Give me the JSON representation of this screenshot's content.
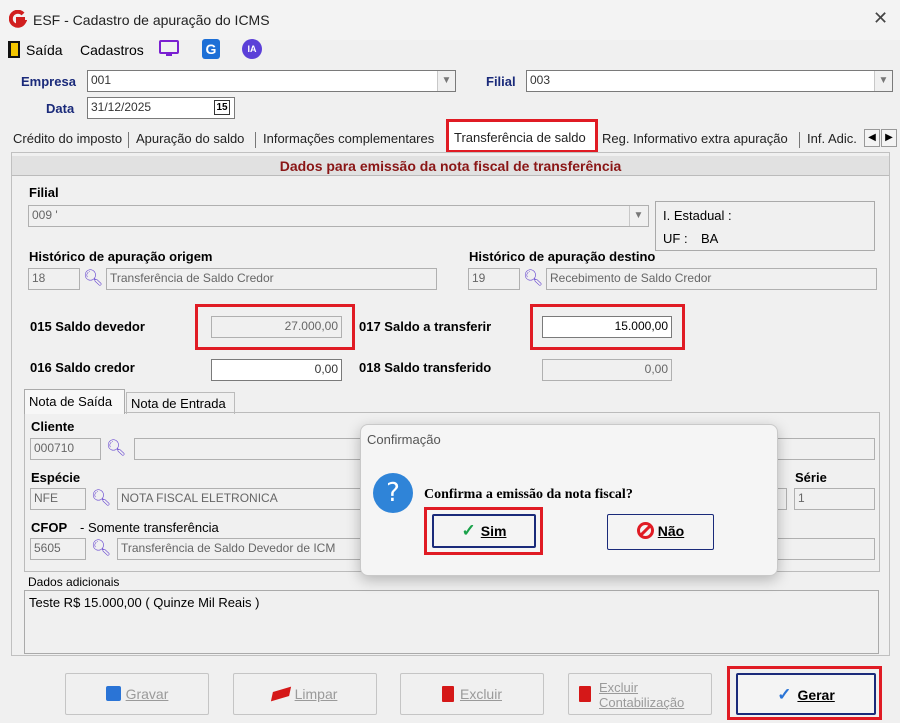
{
  "window": {
    "title": "ESF - Cadastro de apuração do ICMS"
  },
  "menu": {
    "exit": "Saída",
    "registrations": "Cadastros",
    "ai": "IA",
    "g": "G"
  },
  "header": {
    "company_label": "Empresa",
    "company_value": "001",
    "branch_label": "Filial",
    "branch_value": "003",
    "date_label": "Data",
    "date_value": "31/12/2025",
    "calendar": "15"
  },
  "tabs": [
    "Crédito do imposto",
    "Apuração do saldo",
    "Informações complementares",
    "Transferência de saldo",
    "Reg. Informativo extra apuração",
    "Inf. Adic."
  ],
  "panel": {
    "title": "Dados para emissão da nota fiscal de transferência",
    "branch_label": "Filial",
    "branch_value": "009 '",
    "state_reg_label": "I. Estadual :",
    "uf_label": "UF :",
    "uf_value": "BA",
    "hist_origin_label": "Histórico de apuração origem",
    "hist_origin_code": "18",
    "hist_origin_desc": "Transferência de Saldo Credor",
    "hist_dest_label": "Histórico de apuração destino",
    "hist_dest_code": "19",
    "hist_dest_desc": "Recebimento de Saldo Credor",
    "debit_label": "015  Saldo devedor",
    "debit_value": "27.000,00",
    "transfer_label": "017  Saldo a transferir",
    "transfer_value": "15.000,00",
    "credit_label": "016  Saldo credor",
    "credit_value": "0,00",
    "transferred_label": "018  Saldo transferido",
    "transferred_value": "0,00"
  },
  "subtabs": [
    "Nota de Saída",
    "Nota de Entrada"
  ],
  "note": {
    "client_label": "Cliente",
    "client_code": "000710",
    "species_label": "Espécie",
    "species_code": "NFE",
    "species_desc": "NOTA FISCAL ELETRONICA",
    "series_label": "Série",
    "series_value": "1",
    "cfop_label": "CFOP",
    "cfop_hint": "- Somente transferência",
    "cfop_code": "5605",
    "cfop_desc": "Transferência de Saldo Devedor de ICM"
  },
  "additional": {
    "label": "Dados adicionais",
    "value": "Teste R$ 15.000,00 ( Quinze Mil Reais )"
  },
  "buttons": {
    "save": "Gravar",
    "clear": "Limpar",
    "delete": "Excluir",
    "delete_accounting_1": "Excluir",
    "delete_accounting_2": "Contabilização",
    "generate": "Gerar"
  },
  "dialog": {
    "title": "Confirmação",
    "message": "Confirma a emissão da nota fiscal?",
    "yes": "Sim",
    "no": "Não"
  },
  "colors": {
    "highlight": "#e01b24",
    "panel_title": "#8a1616",
    "label_navy": "#1a2a7a",
    "question": "#2f84d8"
  }
}
